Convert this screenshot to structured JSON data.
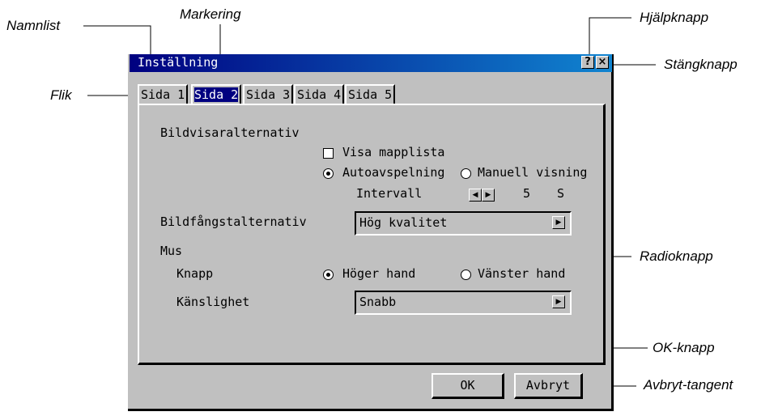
{
  "annotations": {
    "namnlist": "Namnlist",
    "markering": "Markering",
    "hjalpknapp": "Hjälpknapp",
    "stangknapp": "Stängknapp",
    "flik": "Flik",
    "radioknapp": "Radioknapp",
    "okknapp": "OK-knapp",
    "avbryttangent": "Avbryt-tangent"
  },
  "window": {
    "title": "Inställning",
    "help_glyph": "?",
    "close_glyph": "×"
  },
  "tabs": [
    {
      "label": "Sida 1",
      "selected": false
    },
    {
      "label": "Sida 2",
      "selected": true
    },
    {
      "label": "Sida 3",
      "selected": false
    },
    {
      "label": "Sida 4",
      "selected": false
    },
    {
      "label": "Sida 5",
      "selected": false
    }
  ],
  "viewer": {
    "heading": "Bildvisaralternativ",
    "show_folder_list": "Visa mapplista",
    "show_folder_list_checked": false,
    "autoplay": "Autoavspelning",
    "manual": "Manuell visning",
    "selected_mode": "autoplay",
    "interval_label": "Intervall",
    "interval_value": "5",
    "interval_unit": "S"
  },
  "capture": {
    "label": "Bildfångstalternativ",
    "value": "Hög kvalitet"
  },
  "mouse": {
    "heading": "Mus",
    "button_label": "Knapp",
    "right_hand": "Höger hand",
    "left_hand": "Vänster hand",
    "selected_hand": "right",
    "sensitivity_label": "Känslighet",
    "sensitivity_value": "Snabb"
  },
  "buttons": {
    "ok": "OK",
    "cancel": "Avbryt"
  },
  "icons": {
    "combo_arrow": "right-arrow-icon",
    "interval_left": "left-arrow-icon",
    "interval_right": "right-arrow-icon"
  }
}
